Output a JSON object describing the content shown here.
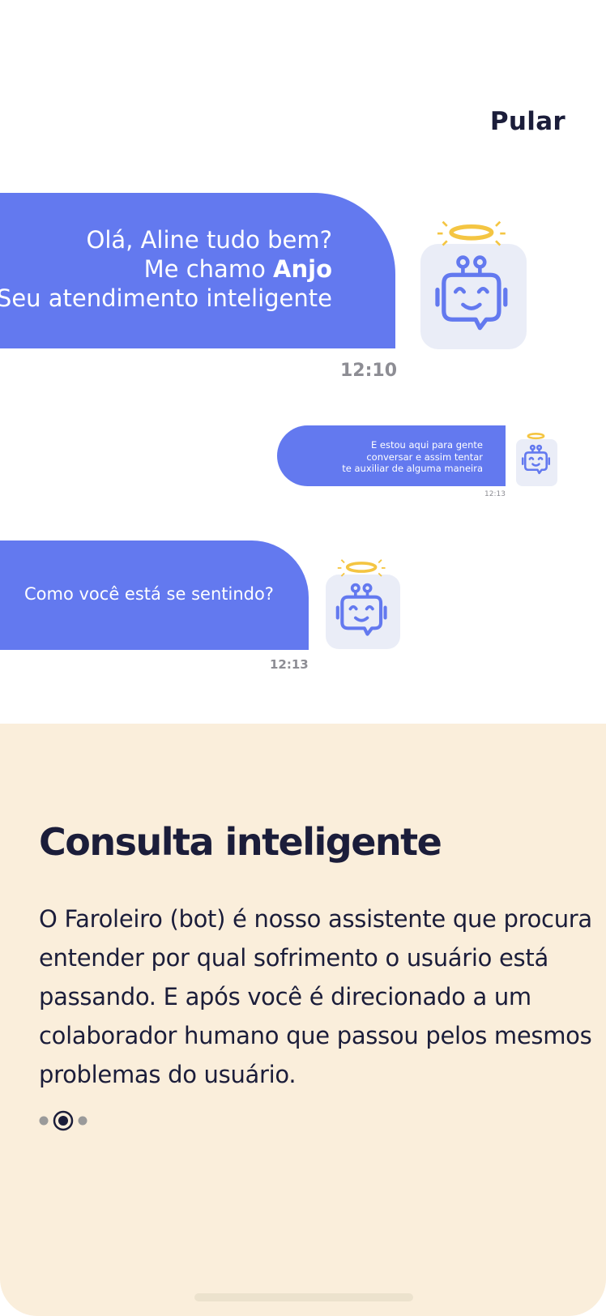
{
  "header": {
    "skip_label": "Pular"
  },
  "chat": {
    "message1": {
      "line1": "Olá, Aline tudo bem?",
      "line2_prefix": "Me chamo ",
      "line2_name": "Anjo",
      "line3": "Seu atendimento inteligente",
      "time": "12:10"
    },
    "message2": {
      "line1": "E estou aqui para gente",
      "line2": "conversar e assim tentar",
      "line3": "te auxiliar de alguma maneira",
      "time": "12:13"
    },
    "message3": {
      "text": "Como você está se sentindo?",
      "time": "12:13"
    },
    "avatar_icon": "robot-angel-icon"
  },
  "onboarding": {
    "title": "Consulta inteligente",
    "description": "O Faroleiro (bot) é nosso assistente que procura entender por qual sofrimento o usuário está passando. E após você é direcionado a um colaborador humano que passou pelos mesmos problemas do usuário.",
    "page_count": 3,
    "current_page": 2
  },
  "colors": {
    "bubble": "#6379ef",
    "panel": "#faeedb",
    "title": "#1b1d3a",
    "halo": "#f4c542",
    "avatar_bg": "#eaedf7"
  }
}
